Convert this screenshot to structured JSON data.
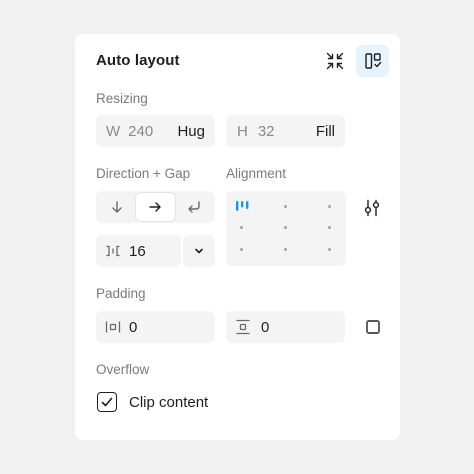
{
  "header": {
    "title": "Auto layout"
  },
  "resizing": {
    "label": "Resizing",
    "width": {
      "axis": "W",
      "value": "240",
      "mode": "Hug"
    },
    "height": {
      "axis": "H",
      "value": "32",
      "mode": "Fill"
    }
  },
  "direction": {
    "label": "Direction + Gap",
    "selected": "horizontal",
    "gap": "16"
  },
  "alignment": {
    "label": "Alignment",
    "selected": "top-left"
  },
  "padding": {
    "label": "Padding",
    "horizontal": "0",
    "vertical": "0"
  },
  "overflow": {
    "label": "Overflow",
    "clip_label": "Clip content",
    "clip_checked": true
  },
  "colors": {
    "accent": "#0d99ff",
    "accent_bg": "#e5f4ff",
    "panel": "#ffffff",
    "background": "#f1f1f1",
    "field": "#f4f4f4"
  }
}
